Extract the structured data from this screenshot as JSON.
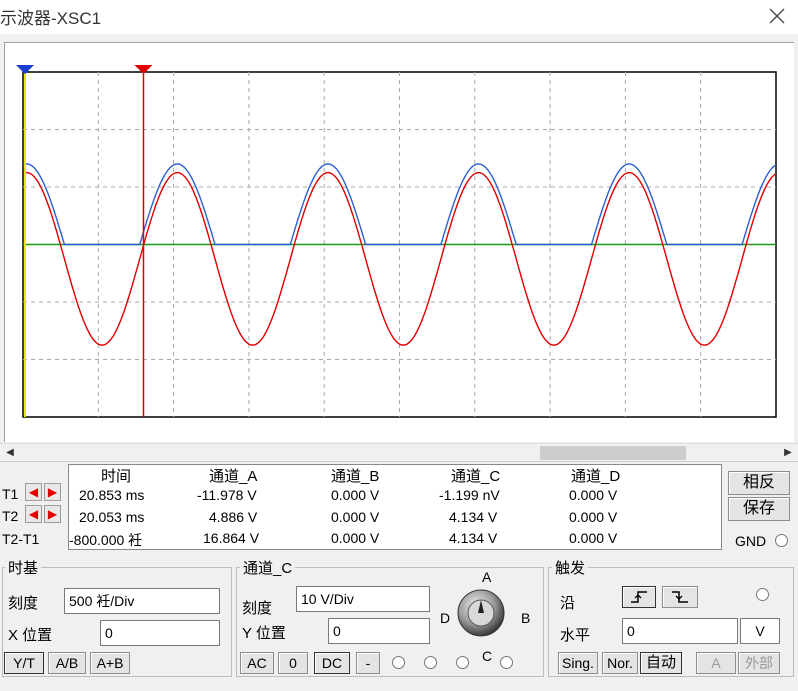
{
  "window": {
    "title": "示波器-XSC1",
    "close": "✕"
  },
  "colors": {
    "trace_a": "#e00000",
    "trace_b": "#2d5fd0",
    "trace_ground": "#1a9a1a",
    "cursor_t1": "#e00000",
    "cursor_t2": "#e8e800",
    "grid": "#a8a8a8"
  },
  "readout": {
    "headers": [
      "时间",
      "通道_A",
      "通道_B",
      "通道_C",
      "通道_D"
    ],
    "rows": [
      {
        "label": "T1",
        "time": "20.853 ms",
        "a": "-11.978 V",
        "b": "0.000 V",
        "c": "-1.199 nV",
        "d": "0.000 V"
      },
      {
        "label": "T2",
        "time": "20.053 ms",
        "a": "4.886 V",
        "b": "0.000 V",
        "c": "4.134 V",
        "d": "0.000 V"
      },
      {
        "label": "T2-T1",
        "time": "-800.000 衽",
        "a": "16.864 V",
        "b": "0.000 V",
        "c": "4.134 V",
        "d": "0.000 V"
      }
    ]
  },
  "side_buttons": {
    "reverse": "相反",
    "save": "保存",
    "gnd": "GND"
  },
  "timebase": {
    "title": "时基",
    "scale_label": "刻度",
    "scale_value": "500 衽/Div",
    "xpos_label": "X 位置",
    "xpos_value": "0",
    "modes": [
      "Y/T",
      "A/B",
      "A+B"
    ]
  },
  "channel": {
    "title": "通道_C",
    "scale_label": "刻度",
    "scale_value": "10  V/Div",
    "ypos_label": "Y 位置",
    "ypos_value": "0",
    "coupling": [
      "AC",
      "0",
      "DC",
      "-"
    ],
    "knob_labels": {
      "a": "A",
      "b": "B",
      "c": "C",
      "d": "D"
    }
  },
  "trigger": {
    "title": "触发",
    "edge_label": "沿",
    "level_label": "水平",
    "level_value": "0",
    "level_unit": "V",
    "modes": [
      "Sing.",
      "Nor.",
      "自动"
    ],
    "source_a": "A",
    "external": "外部"
  },
  "waveform": {
    "x_axis_range": [
      0,
      10
    ],
    "y_axis_range": [
      -3,
      3
    ],
    "trace_a": {
      "amplitude_div": 1.5,
      "offset_div": -0.25,
      "period_div": 2.0,
      "phase_at_zero_div": 0.45
    },
    "trace_b": {
      "amplitude_div": 1.4,
      "offset_div": 0.0,
      "period_div": 2.0,
      "phase_at_zero_div": 0.45,
      "positive_half_only": true
    },
    "trace_ground_div": 0.0,
    "cursor_t1_div": 1.6,
    "cursor_t2_div": 0.0
  }
}
